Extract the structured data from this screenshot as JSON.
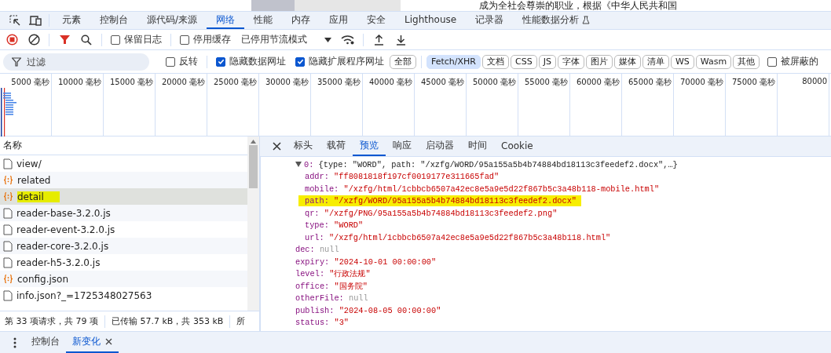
{
  "page_strip": {
    "text": "成为全社会尊崇的职业，根据《中华人民共和国"
  },
  "main_tabs": [
    {
      "label": "元素",
      "selected": false
    },
    {
      "label": "控制台",
      "selected": false
    },
    {
      "label": "源代码/来源",
      "selected": false
    },
    {
      "label": "网络",
      "selected": true
    },
    {
      "label": "性能",
      "selected": false
    },
    {
      "label": "内存",
      "selected": false
    },
    {
      "label": "应用",
      "selected": false
    },
    {
      "label": "安全",
      "selected": false
    },
    {
      "label": "Lighthouse",
      "selected": false
    },
    {
      "label": "记录器",
      "selected": false
    },
    {
      "label": "性能数据分析",
      "selected": false,
      "experimental": true
    }
  ],
  "toolbar": {
    "checkboxes": [
      {
        "label": "保留日志",
        "checked": false
      },
      {
        "label": "停用缓存",
        "checked": false
      }
    ],
    "throttle": {
      "value": "已停用节流模式"
    }
  },
  "filter_bar": {
    "placeholder": "过滤",
    "checkboxes": [
      {
        "label": "反转",
        "checked": false
      },
      {
        "label": "隐藏数据网址",
        "checked": true
      },
      {
        "label": "隐藏扩展程序网址",
        "checked": true
      }
    ],
    "chips": [
      {
        "label": "全部",
        "selected": false
      },
      {
        "label": "Fetch/XHR",
        "selected": true
      },
      {
        "label": "文档",
        "selected": false
      },
      {
        "label": "CSS",
        "selected": false
      },
      {
        "label": "JS",
        "selected": false
      },
      {
        "label": "字体",
        "selected": false
      },
      {
        "label": "图片",
        "selected": false
      },
      {
        "label": "媒体",
        "selected": false
      },
      {
        "label": "清单",
        "selected": false
      },
      {
        "label": "WS",
        "selected": false
      },
      {
        "label": "Wasm",
        "selected": false
      },
      {
        "label": "其他",
        "selected": false
      }
    ],
    "blocked": {
      "label": "被屏蔽的",
      "checked": false
    }
  },
  "timeline": {
    "ticks": [
      "5000 毫秒",
      "10000 毫秒",
      "15000 毫秒",
      "20000 毫秒",
      "25000 毫秒",
      "30000 毫秒",
      "35000 毫秒",
      "40000 毫秒",
      "45000 毫秒",
      "50000 毫秒",
      "55000 毫秒",
      "60000 毫秒",
      "65000 毫秒",
      "70000 毫秒",
      "75000 毫秒",
      "80000"
    ]
  },
  "requests": {
    "column": "名称",
    "rows": [
      {
        "name": "view/",
        "kind": "doc",
        "selected": false
      },
      {
        "name": "related",
        "kind": "xhr",
        "selected": false
      },
      {
        "name": "detail",
        "kind": "xhr",
        "selected": true
      },
      {
        "name": "reader-base-3.2.0.js",
        "kind": "doc",
        "selected": false
      },
      {
        "name": "reader-event-3.2.0.js",
        "kind": "doc",
        "selected": false
      },
      {
        "name": "reader-core-3.2.0.js",
        "kind": "doc",
        "selected": false
      },
      {
        "name": "reader-h5-3.2.0.js",
        "kind": "doc",
        "selected": false
      },
      {
        "name": "config.json",
        "kind": "xhr",
        "selected": false
      },
      {
        "name": "info.json?_=1725348027563",
        "kind": "doc",
        "selected": false
      }
    ]
  },
  "status_bar": [
    "第 33 项请求，共 79 项",
    "已传输 57.7 kB，共 353 kB",
    "所"
  ],
  "detail_tabs": [
    {
      "label": "标头",
      "selected": false
    },
    {
      "label": "载荷",
      "selected": false
    },
    {
      "label": "预览",
      "selected": true
    },
    {
      "label": "响应",
      "selected": false
    },
    {
      "label": "启动器",
      "selected": false
    },
    {
      "label": "时间",
      "selected": false
    },
    {
      "label": "Cookie",
      "selected": false
    }
  ],
  "preview": [
    {
      "key": "0:",
      "summary": "{type: \"WORD\", path: \"/xzfg/WORD/95a155a5b4b74884bd18113c3feedef2.docx\",…}",
      "expanded": true,
      "children": [
        {
          "key": "addr:",
          "value": "\"ff8081818f197cf0019177e311665fad\"",
          "kind": "string",
          "highlighted": false
        },
        {
          "key": "mobile:",
          "value": "\"/xzfg/html/1cbbcb6507a42ec8e5a9e5d22f867b5c3a48b118-mobile.html\"",
          "kind": "string",
          "highlighted": false
        },
        {
          "key": "path:",
          "value": "\"/xzfg/WORD/95a155a5b4b74884bd18113c3feedef2.docx\"",
          "kind": "string",
          "highlighted": true
        },
        {
          "key": "qr:",
          "value": "\"/xzfg/PNG/95a155a5b4b74884bd18113c3feedef2.png\"",
          "kind": "string",
          "highlighted": false
        },
        {
          "key": "type:",
          "value": "\"WORD\"",
          "kind": "string",
          "highlighted": false
        },
        {
          "key": "url:",
          "value": "\"/xzfg/html/1cbbcb6507a42ec8e5a9e5d22f867b5c3a48b118.html\"",
          "kind": "string",
          "highlighted": false
        }
      ]
    },
    {
      "key": "dec:",
      "value": "null",
      "kind": "null",
      "highlighted": false
    },
    {
      "key": "expiry:",
      "value": "\"2024-10-01 00:00:00\"",
      "kind": "string",
      "highlighted": false
    },
    {
      "key": "level:",
      "value": "\"行政法规\"",
      "kind": "string",
      "highlighted": false
    },
    {
      "key": "office:",
      "value": "\"国务院\"",
      "kind": "string",
      "highlighted": false
    },
    {
      "key": "otherFile:",
      "value": "null",
      "kind": "null",
      "highlighted": false
    },
    {
      "key": "publish:",
      "value": "\"2024-08-05 00:00:00\"",
      "kind": "string",
      "highlighted": false
    },
    {
      "key": "status:",
      "value": "\"3\"",
      "kind": "string",
      "highlighted": false
    }
  ],
  "drawer_tabs": [
    {
      "label": "控制台",
      "selected": false,
      "closable": false
    },
    {
      "label": "新变化",
      "selected": true,
      "closable": true
    }
  ]
}
